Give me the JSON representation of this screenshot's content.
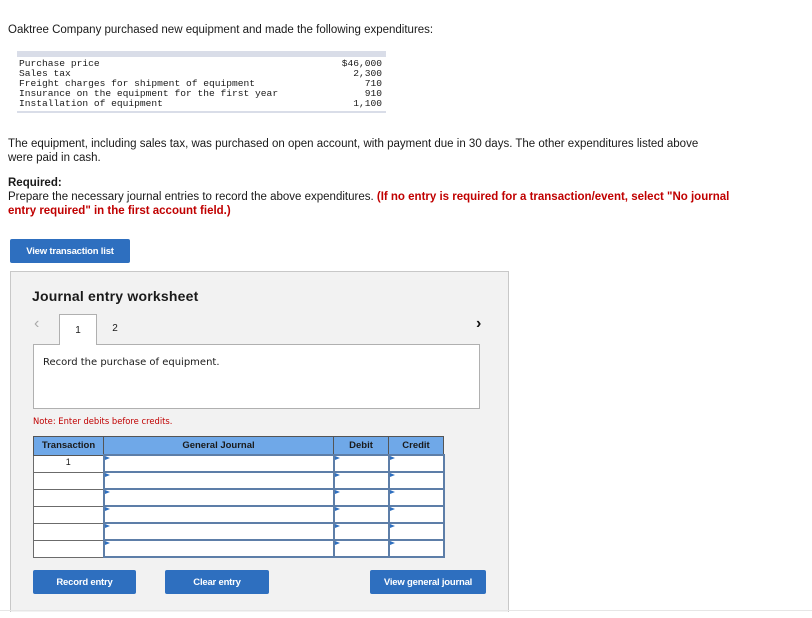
{
  "intro": "Oaktree Company purchased new equipment and made the following expenditures:",
  "expenditures": [
    {
      "label": "Purchase price",
      "amount": "$46,000"
    },
    {
      "label": "Sales tax",
      "amount": "2,300"
    },
    {
      "label": "Freight charges for shipment of equipment",
      "amount": "710"
    },
    {
      "label": "Insurance on the equipment for the first year",
      "amount": "910"
    },
    {
      "label": "Installation of equipment",
      "amount": "1,100"
    }
  ],
  "paragraph": "The equipment, including sales tax, was purchased on open account, with payment due in 30 days. The other expenditures listed above were paid in cash.",
  "required": {
    "label": "Required:",
    "text": "Prepare the necessary journal entries to record the above expenditures. ",
    "hint": "(If no entry is required for a transaction/event, select \"No journal entry required\" in the first account field.)"
  },
  "buttons": {
    "view_transaction_list": "View transaction list",
    "record_entry": "Record entry",
    "clear_entry": "Clear entry",
    "view_general_journal": "View general journal"
  },
  "worksheet": {
    "title": "Journal entry worksheet",
    "tabs": [
      "1",
      "2"
    ],
    "active_tab": "1",
    "description": "Record the purchase of equipment.",
    "note": "Note: Enter debits before credits.",
    "columns": [
      "Transaction",
      "General Journal",
      "Debit",
      "Credit"
    ],
    "rows": [
      {
        "transaction": "1",
        "account": "",
        "debit": "",
        "credit": ""
      },
      {
        "transaction": "",
        "account": "",
        "debit": "",
        "credit": ""
      },
      {
        "transaction": "",
        "account": "",
        "debit": "",
        "credit": ""
      },
      {
        "transaction": "",
        "account": "",
        "debit": "",
        "credit": ""
      },
      {
        "transaction": "",
        "account": "",
        "debit": "",
        "credit": ""
      },
      {
        "transaction": "",
        "account": "",
        "debit": "",
        "credit": ""
      }
    ]
  },
  "icons": {
    "prev": "chevron-left-icon",
    "next": "chevron-right-icon",
    "dropdown": "dropdown-flag-icon"
  },
  "colors": {
    "button": "#2e6fbf",
    "header": "#6fa8e8",
    "hint": "#c00000",
    "panel": "#f2f2f2"
  }
}
